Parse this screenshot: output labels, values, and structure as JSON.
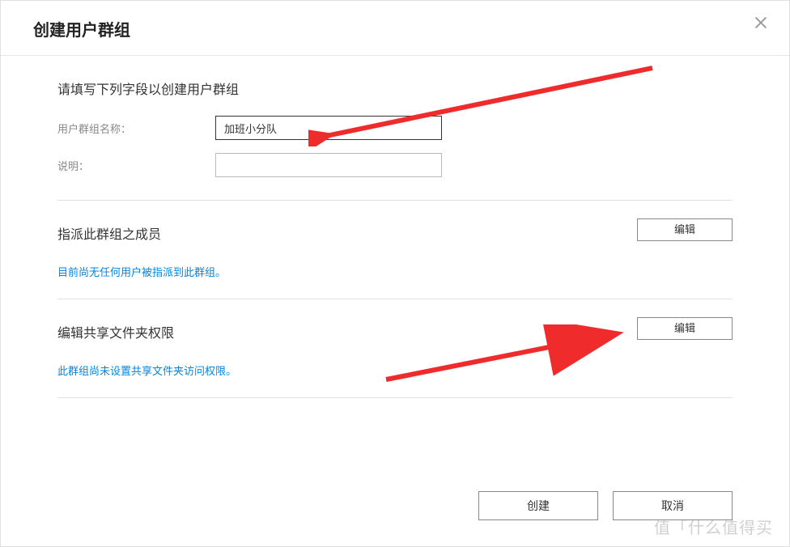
{
  "modal": {
    "title": "创建用户群组",
    "close_label": "关闭"
  },
  "form_section": {
    "intro": "请填写下列字段以创建用户群组",
    "group_name_label": "用户群组名称：",
    "group_name_value": "加班小分队",
    "description_label": "说明：",
    "description_value": ""
  },
  "members_section": {
    "title": "指派此群组之成员",
    "edit_button": "编辑",
    "info": "目前尚无任何用户被指派到此群组。"
  },
  "permissions_section": {
    "title": "编辑共享文件夹权限",
    "edit_button": "编辑",
    "info": "此群组尚未设置共享文件夹访问权限。"
  },
  "footer": {
    "create": "创建",
    "cancel": "取消"
  },
  "watermark": "值「什么值得买"
}
